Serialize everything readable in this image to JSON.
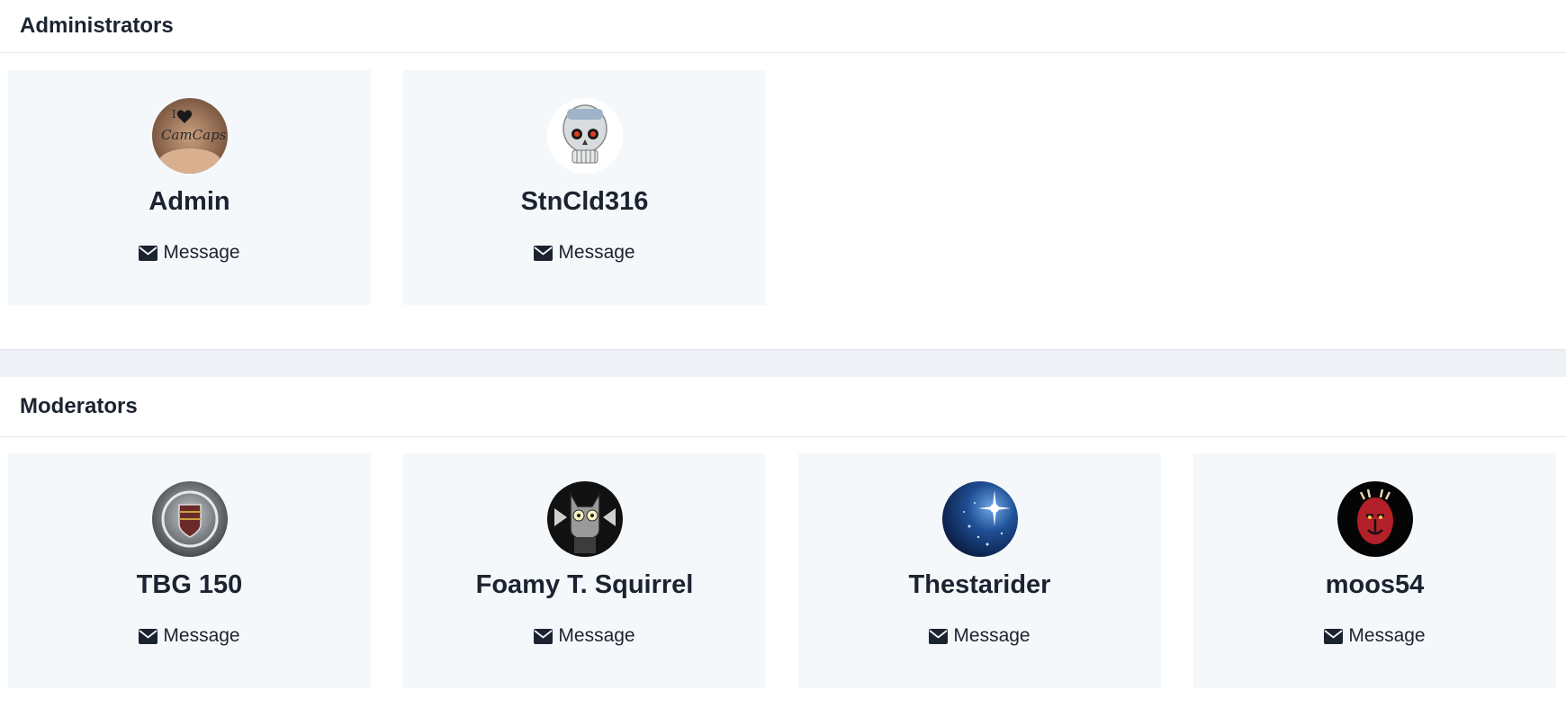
{
  "administrators": {
    "title": "Administrators",
    "members": [
      {
        "name": "Admin",
        "avatar_icon": "hand-heart-avatar-icon",
        "message_label": "Message"
      },
      {
        "name": "StnCld316",
        "avatar_icon": "skull-avatar-icon",
        "message_label": "Message"
      }
    ]
  },
  "moderators": {
    "title": "Moderators",
    "members": [
      {
        "name": "TBG 150",
        "avatar_icon": "cadillac-emblem-avatar-icon",
        "message_label": "Message"
      },
      {
        "name": "Foamy T. Squirrel",
        "avatar_icon": "squirrel-avatar-icon",
        "message_label": "Message"
      },
      {
        "name": "Thestarider",
        "avatar_icon": "star-avatar-icon",
        "message_label": "Message"
      },
      {
        "name": "moos54",
        "avatar_icon": "darth-maul-avatar-icon",
        "message_label": "Message"
      }
    ]
  },
  "colors": {
    "card_background": "#f5f8fb",
    "text": "#1c2330",
    "band": "#eef1f5"
  }
}
